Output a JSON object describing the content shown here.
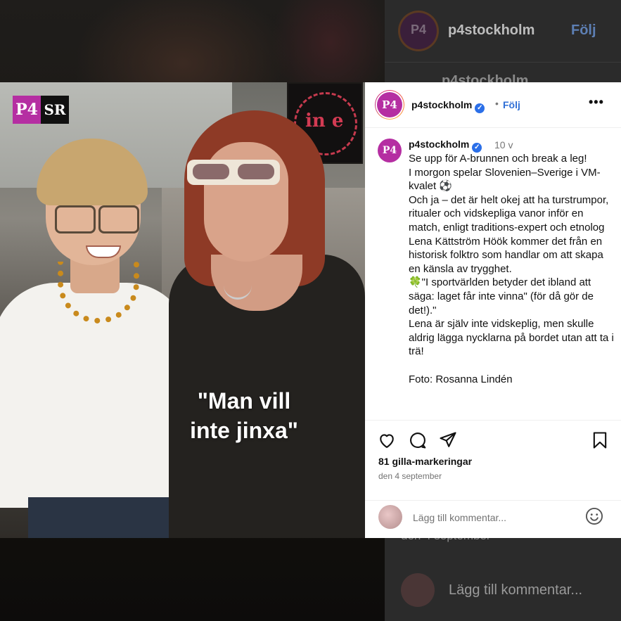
{
  "background": {
    "username": "p4stockholm",
    "follow_label": "Följ",
    "username_second": "p4stockholm",
    "date": "den 4 september",
    "comment_placeholder": "Lägg till kommentar...",
    "avatar_text": "P4"
  },
  "post": {
    "image": {
      "logo_p4": "P4",
      "logo_sr": "SR",
      "caption_line1": "\"Man vill",
      "caption_line2": "inte jinxa\"",
      "board_text": "in e"
    },
    "header": {
      "avatar_text": "P4",
      "username": "p4stockholm",
      "verified": "✓",
      "separator": "•",
      "follow_label": "Följ",
      "more_label": "•••"
    },
    "caption": {
      "avatar_text": "P4",
      "username": "p4stockholm",
      "verified": "✓",
      "time": "10 v",
      "text": "Se upp för A-brunnen och break a leg!\nI morgon spelar Slovenien–Sverige i VM-kvalet ⚽\nOch ja – det är helt okej att ha turstrumpor, ritualer och vidskepliga vanor inför en match, enligt traditions-expert och etnolog Lena Kättström Höök kommer det från en historisk folktro som handlar om att skapa en känsla av trygghet.\n🍀\"I sportvärlden betyder det ibland att säga: laget får inte vinna\" (för då gör de det!).\"\nLena är själv inte vidskeplig, men skulle aldrig lägga nycklarna på bordet utan att ta i trä!\n\nFoto: Rosanna Lindén"
    },
    "likes": "81 gilla-markeringar",
    "date": "den 4 september",
    "comment_placeholder": "Lägg till kommentar..."
  },
  "icons": {
    "like": "heart-icon",
    "comment": "comment-icon",
    "share": "share-icon",
    "save": "bookmark-icon",
    "emoji": "emoji-icon"
  },
  "colors": {
    "brand": "#b52ea2",
    "link": "#2f6fd6",
    "verified": "#2b6fe8"
  }
}
